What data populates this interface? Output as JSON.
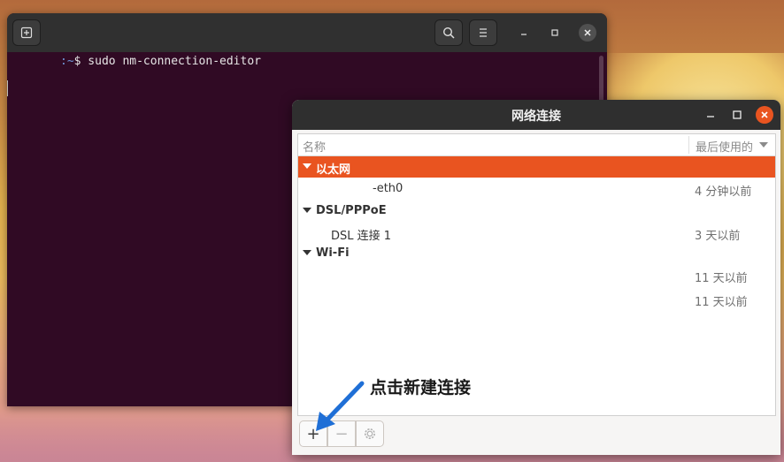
{
  "terminal": {
    "prompt_sep": ":",
    "prompt_path": "~",
    "prompt_symbol": "$",
    "command": " sudo nm-connection-editor",
    "icons": [
      "new-tab-icon",
      "search-icon",
      "menu-icon",
      "minimize-icon",
      "maximize-icon",
      "close-icon"
    ]
  },
  "dialog": {
    "title": "网络连接",
    "columns": {
      "name": "名称",
      "last_used": "最后使用的"
    },
    "groups": [
      {
        "label": "以太网",
        "selected": true,
        "items": [
          {
            "name": "-eth0",
            "time": "4 分钟以前"
          }
        ]
      },
      {
        "label": "DSL/PPPoE",
        "selected": false,
        "items": [
          {
            "name": "DSL 连接 1",
            "time": "3 天以前"
          }
        ]
      },
      {
        "label": "Wi-Fi",
        "selected": false,
        "items": [
          {
            "name": "",
            "time": "11 天以前"
          },
          {
            "name": "",
            "time": "11 天以前"
          }
        ]
      }
    ],
    "toolbar": {
      "add": "+",
      "remove": "−"
    }
  },
  "annotation": {
    "text": "点击新建连接",
    "arrow_color": "#1f6fd6"
  },
  "colors": {
    "accent": "#e95420",
    "terminal_bg": "#300a24"
  }
}
